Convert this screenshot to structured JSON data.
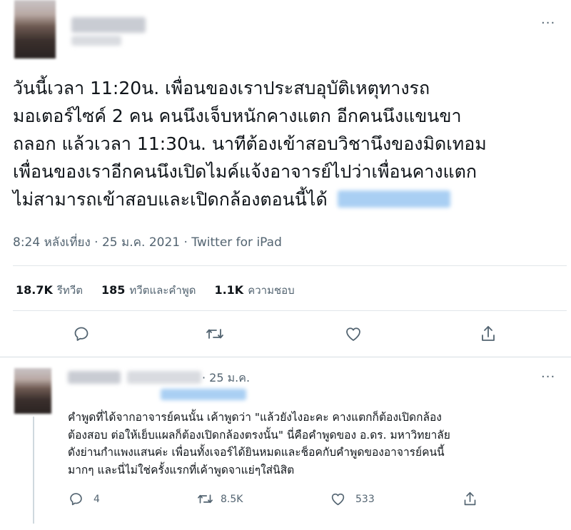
{
  "tweet": {
    "more_label": "···",
    "lines": [
      "วันนี้เวลา 11:20น. เพื่อนของเราประสบอุบัติเหตุทางรถ",
      "มอเตอร์ไซค์ 2 คน คนนึงเจ็บหนักคางแตก อีกคนนึงแขนขา",
      "ถลอก แล้วเวลา 11:30น. นาทีต้องเข้าสอบวิชานึงของมิดเทอม",
      "เพื่อนของเราอีกคนนึงเปิดไมค์แจ้งอาจารย์ไปว่าเพื่อนคางแตก",
      "ไม่สามารถเข้าสอบและเปิดกล้องตอนนี้ได้"
    ],
    "timestamp": "8:24 หลังเที่ยง · 25 ม.ค. 2021 · Twitter for iPad",
    "stats": [
      {
        "value": "18.7K",
        "label": "รีทวีต"
      },
      {
        "value": "185",
        "label": "ทวีตและคำพูด"
      },
      {
        "value": "1.1K",
        "label": "ความชอบ"
      }
    ]
  },
  "reply": {
    "date": "· 25 ม.ค.",
    "more_label": "···",
    "lines": [
      "คำพูดที่ได้จากอาจารย์คนนั้น  เค้าพูดว่า \"แล้วยังไงอะคะ คางแตกก็ต้องเปิดกล้อง",
      "ต้องสอบ ต่อให้เย็บแผลก็ต้องเปิดกล้องตรงนั้น\" นี่คือคำพูดของ อ.ดร. มหาวิทยาลัย",
      "ดังย่านกำแพงแสนค่ะ เพื่อนทั้งเจอร์ได้ยินหมดและช็อคกับคำพูดของอาจารย์คนนี้",
      "มากๆ และนี่ไม่ใช่ครั้งแรกที่เค้าพูดจาแย่ๆใส่นิสิต"
    ],
    "counts": {
      "replies": "4",
      "retweets": "8.5K",
      "likes": "533"
    }
  },
  "colors": {
    "text": "#0f1419",
    "muted": "#536471",
    "divider": "#e1e6ea",
    "icon": "#536471"
  }
}
